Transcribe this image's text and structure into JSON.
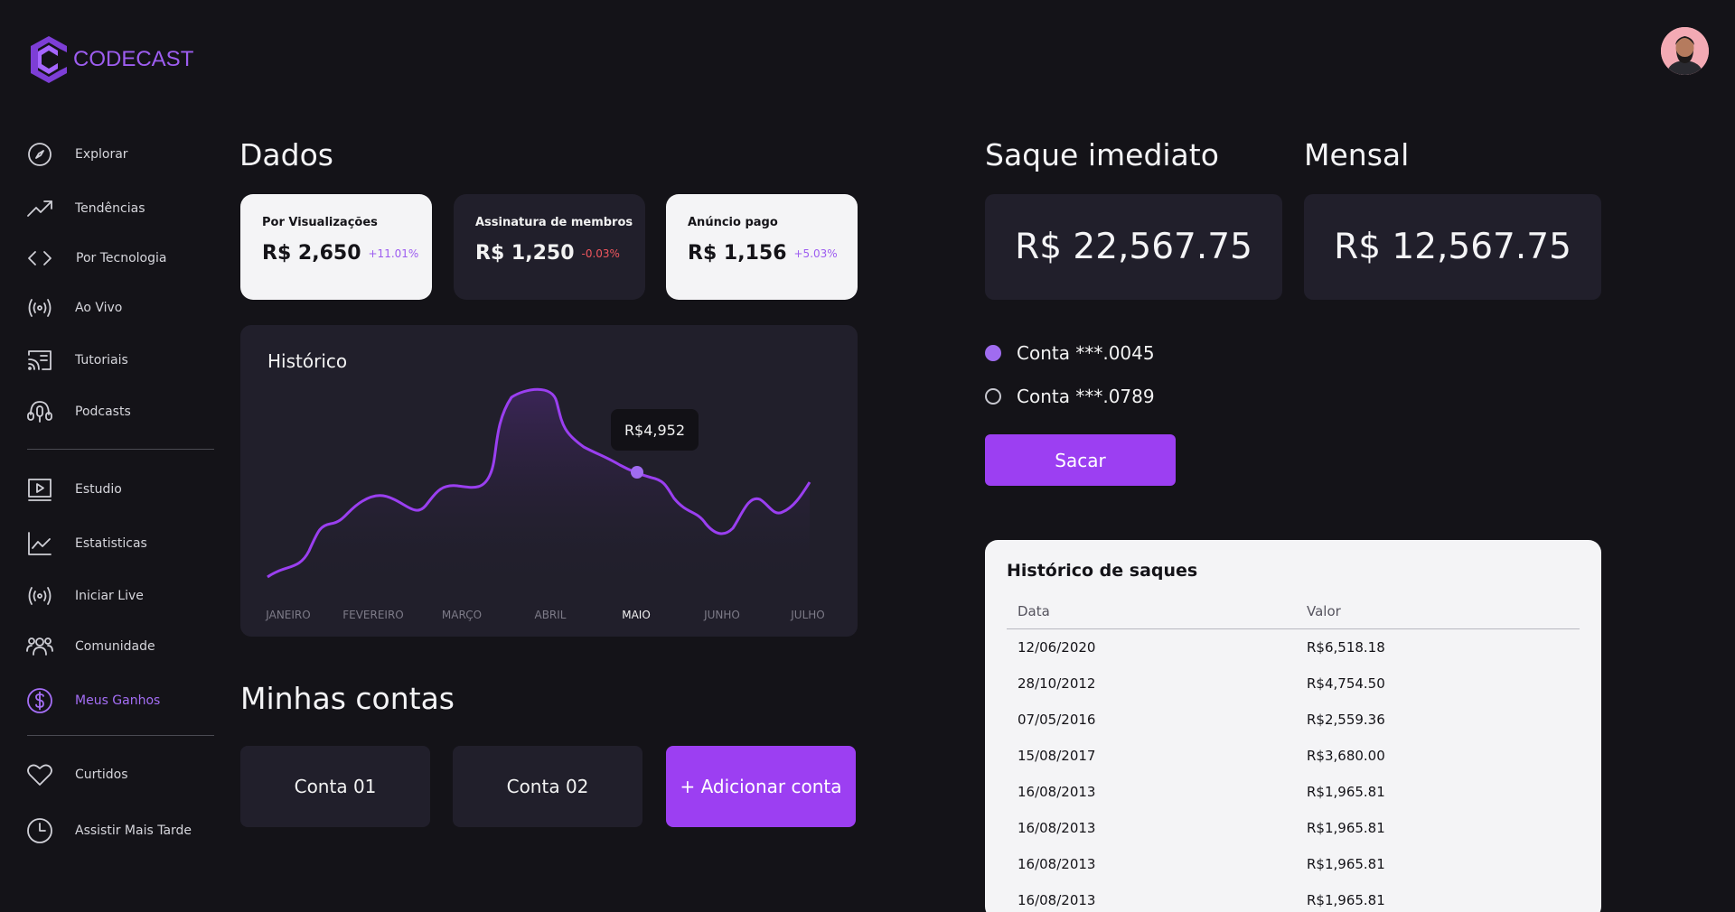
{
  "brand": {
    "name": "CODECAST",
    "accent": "#9d5df0"
  },
  "sidebar": {
    "items": [
      {
        "label": "Explorar",
        "icon": "compass-icon"
      },
      {
        "label": "Tendências",
        "icon": "trending-up-icon"
      },
      {
        "label": "Por Tecnologia",
        "icon": "code-icon"
      },
      {
        "label": "Ao Vivo",
        "icon": "broadcast-icon"
      },
      {
        "label": "Tutoriais",
        "icon": "cast-icon"
      },
      {
        "label": "Podcasts",
        "icon": "podcast-icon"
      },
      {
        "label": "Estudio",
        "icon": "video-icon"
      },
      {
        "label": "Estatisticas",
        "icon": "line-chart-icon"
      },
      {
        "label": "Iniciar Live",
        "icon": "broadcast-icon"
      },
      {
        "label": "Comunidade",
        "icon": "users-icon"
      },
      {
        "label": "Meus Ganhos",
        "icon": "dollar-icon",
        "active": true
      },
      {
        "label": "Curtidos",
        "icon": "heart-icon"
      },
      {
        "label": "Assistir Mais Tarde",
        "icon": "clock-icon"
      }
    ]
  },
  "dados": {
    "title": "Dados",
    "cards": [
      {
        "label": "Por Visualizações",
        "value": "R$ 2,650",
        "change": "+11.01%",
        "trend": "up",
        "theme": "light"
      },
      {
        "label": "Assinatura de membros",
        "value": "R$ 1,250",
        "change": "-0.03%",
        "trend": "down",
        "theme": "dark"
      },
      {
        "label": "Anúncio pago",
        "value": "R$ 1,156",
        "change": "+5.03%",
        "trend": "up",
        "theme": "light"
      }
    ]
  },
  "historico": {
    "title": "Histórico",
    "tooltip": "R$4,952",
    "active_month": "MAIO",
    "months": [
      "JANEIRO",
      "FEVEREIRO",
      "MARÇO",
      "ABRIL",
      "MAIO",
      "JUNHO",
      "JULHO"
    ]
  },
  "minhas_contas": {
    "title": "Minhas contas",
    "buttons": [
      "Conta 01",
      "Conta 02",
      "+ Adicionar conta"
    ]
  },
  "saque": {
    "title": "Saque imediato",
    "value": "R$ 22,567.75"
  },
  "mensal": {
    "title": "Mensal",
    "value": "R$ 12,567.75"
  },
  "accounts": [
    {
      "label": "Conta ***.0045",
      "selected": true
    },
    {
      "label": "Conta ***.0789",
      "selected": false
    }
  ],
  "sacar_label": "Sacar",
  "historico_saques": {
    "title": "Histórico de saques",
    "columns": [
      "Data",
      "Valor"
    ],
    "rows": [
      [
        "12/06/2020",
        "R$6,518.18"
      ],
      [
        "28/10/2012",
        "R$4,754.50"
      ],
      [
        "07/05/2016",
        "R$2,559.36"
      ],
      [
        "15/08/2017",
        "R$3,680.00"
      ],
      [
        "16/08/2013",
        "R$1,965.81"
      ],
      [
        "16/08/2013",
        "R$1,965.81"
      ],
      [
        "16/08/2013",
        "R$1,965.81"
      ],
      [
        "16/08/2013",
        "R$1,965.81"
      ]
    ]
  }
}
